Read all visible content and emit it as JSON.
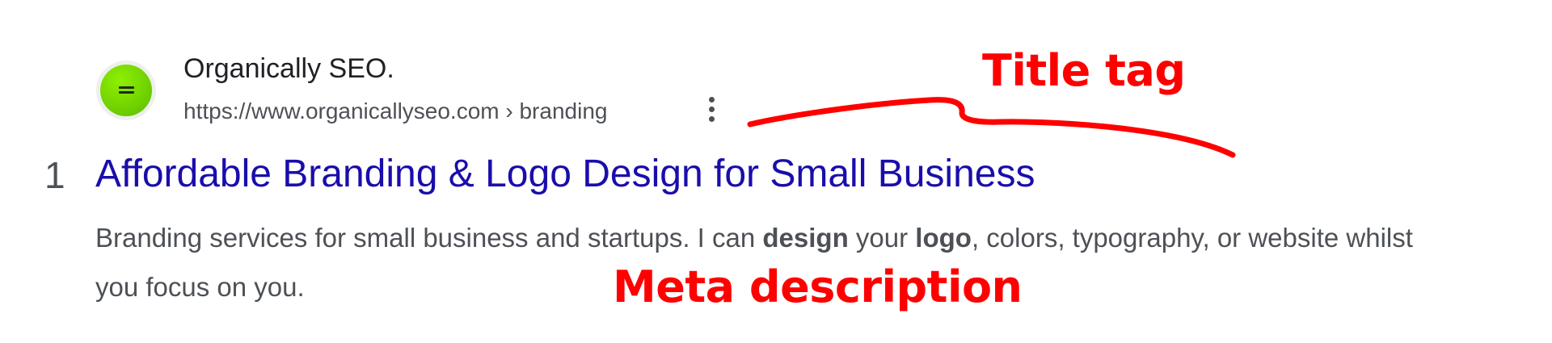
{
  "result": {
    "site_name": "Organically SEO.",
    "url": "https://www.organicallyseo.com › branding",
    "rank": "1",
    "title": "Affordable Branding & Logo Design for Small Business",
    "snippet": {
      "part1": "Branding services for small business and startups. I can ",
      "bold1": "design",
      "part2": " your ",
      "bold2": "logo",
      "part3": ", colors, typography, or website whilst you focus on you."
    },
    "favicon_icon": "green-circle-menu-icon",
    "more_icon": "three-dots-vertical-icon"
  },
  "annotations": {
    "title_tag": "Title tag",
    "meta_description": "Meta description",
    "color": "#ff0000"
  },
  "colors": {
    "title_link": "#1a0dab",
    "url_text": "#4d5156",
    "site_name": "#202124",
    "favicon": "#72d400"
  }
}
